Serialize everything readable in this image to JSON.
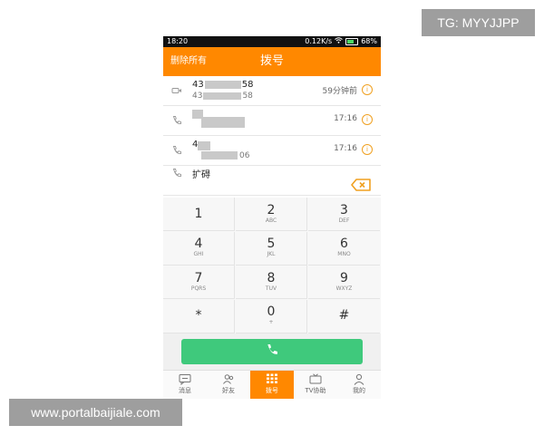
{
  "watermark_top": "TG: MYYJJPP",
  "watermark_bottom": "www.portalbaijiale.com",
  "statusbar": {
    "time": "18:20",
    "network_speed": "0.12K/s",
    "battery": "68%",
    "battery_level": 0.68
  },
  "header": {
    "delete_all": "删除所有",
    "title": "拨号"
  },
  "calllog": [
    {
      "icon": "video-call-icon",
      "number": "43",
      "number_suffix": "58",
      "sub": "43",
      "sub_suffix": "58",
      "time": "59分钟前"
    },
    {
      "icon": "phone-icon",
      "number": "",
      "number_suffix": "",
      "sub": "",
      "sub_suffix": "",
      "time": "17:16"
    },
    {
      "icon": "phone-icon",
      "number": "4",
      "number_suffix": "",
      "sub": "",
      "sub_suffix": "06",
      "time": "17:16"
    },
    {
      "icon": "phone-icon",
      "number": "扩碍",
      "number_suffix": "",
      "sub": "",
      "sub_suffix": "",
      "time": ""
    }
  ],
  "keypad": [
    {
      "digit": "1",
      "letters": ""
    },
    {
      "digit": "2",
      "letters": "ABC"
    },
    {
      "digit": "3",
      "letters": "DEF"
    },
    {
      "digit": "4",
      "letters": "GHI"
    },
    {
      "digit": "5",
      "letters": "JKL"
    },
    {
      "digit": "6",
      "letters": "MNO"
    },
    {
      "digit": "7",
      "letters": "PQRS"
    },
    {
      "digit": "8",
      "letters": "TUV"
    },
    {
      "digit": "9",
      "letters": "WXYZ"
    },
    {
      "digit": "*",
      "letters": ""
    },
    {
      "digit": "0",
      "letters": "+"
    },
    {
      "digit": "#",
      "letters": ""
    }
  ],
  "tabs": [
    {
      "label": "消息",
      "icon": "message-icon",
      "active": false
    },
    {
      "label": "好友",
      "icon": "friends-icon",
      "active": false
    },
    {
      "label": "拨号",
      "icon": "dialpad-icon",
      "active": true
    },
    {
      "label": "TV协助",
      "icon": "tv-icon",
      "active": false
    },
    {
      "label": "我的",
      "icon": "profile-icon",
      "active": false
    }
  ],
  "colors": {
    "accent": "#ff8800",
    "call": "#3fc97c",
    "info": "#f0a020"
  }
}
